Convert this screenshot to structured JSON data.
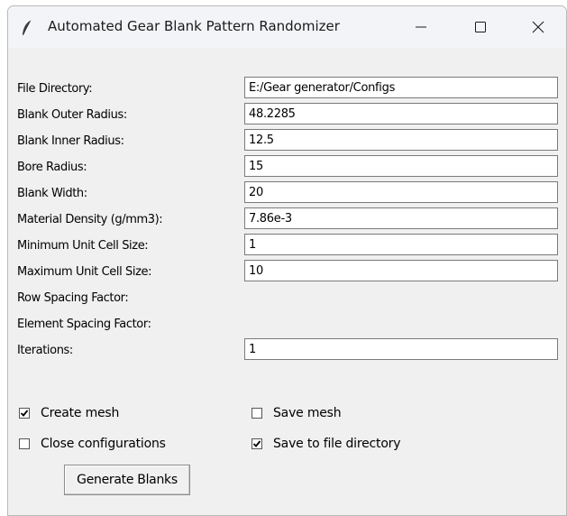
{
  "window": {
    "title": "Automated Gear Blank Pattern Randomizer",
    "icon": "feather-icon",
    "controls": [
      "minimize-icon",
      "maximize-icon",
      "close-icon"
    ]
  },
  "form": {
    "fields": [
      {
        "label": "File Directory:",
        "value": "E:/Gear generator/Configs",
        "has_input": true
      },
      {
        "label": "Blank Outer Radius:",
        "value": "48.2285",
        "has_input": true
      },
      {
        "label": "Blank Inner Radius:",
        "value": "12.5",
        "has_input": true
      },
      {
        "label": "Bore Radius:",
        "value": "15",
        "has_input": true
      },
      {
        "label": "Blank Width:",
        "value": "20",
        "has_input": true
      },
      {
        "label": "Material Density (g/mm3):",
        "value": "7.86e-3",
        "has_input": true
      },
      {
        "label": "Minimum Unit Cell Size:",
        "value": "1",
        "has_input": true
      },
      {
        "label": "Maximum Unit Cell Size:",
        "value": "10",
        "has_input": true
      },
      {
        "label": "Row Spacing Factor:",
        "value": "",
        "has_input": false
      },
      {
        "label": "Element Spacing Factor:",
        "value": "",
        "has_input": false
      },
      {
        "label": "Iterations:",
        "value": "1",
        "has_input": true
      }
    ]
  },
  "options": {
    "create_mesh": {
      "label": "Create mesh",
      "checked": true
    },
    "save_mesh": {
      "label": "Save mesh",
      "checked": false
    },
    "close_configurations": {
      "label": "Close configurations",
      "checked": false
    },
    "save_to_file_directory": {
      "label": "Save to file directory",
      "checked": true
    }
  },
  "actions": {
    "generate_label": "Generate Blanks"
  }
}
